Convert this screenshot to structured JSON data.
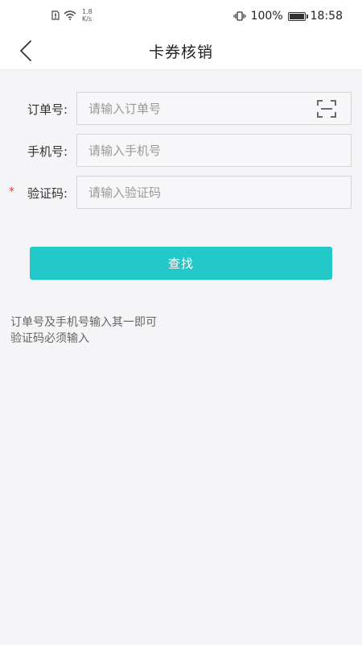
{
  "status_bar": {
    "net_speed_value": "1.8",
    "net_speed_unit": "K/s",
    "battery_percent": "100%",
    "battery_level": 1.0,
    "time": "18:58"
  },
  "nav": {
    "title": "卡券核销",
    "back_icon": "chevron-left-icon"
  },
  "form": {
    "order_no": {
      "label": "订单号:",
      "placeholder": "请输入订单号",
      "value": "",
      "icon": "scan-icon"
    },
    "phone": {
      "label": "手机号:",
      "placeholder": "请输入手机号",
      "value": ""
    },
    "code": {
      "required_mark": "*",
      "label": "验证码:",
      "placeholder": "请输入验证码",
      "value": ""
    }
  },
  "actions": {
    "search_label": "查找"
  },
  "notes": {
    "line1": "订单号及手机号输入其一即可",
    "line2": "验证码必须输入"
  },
  "colors": {
    "accent": "#23c8c8",
    "required": "#e53935",
    "background": "#f5f5f7",
    "header": "#ffffff"
  }
}
